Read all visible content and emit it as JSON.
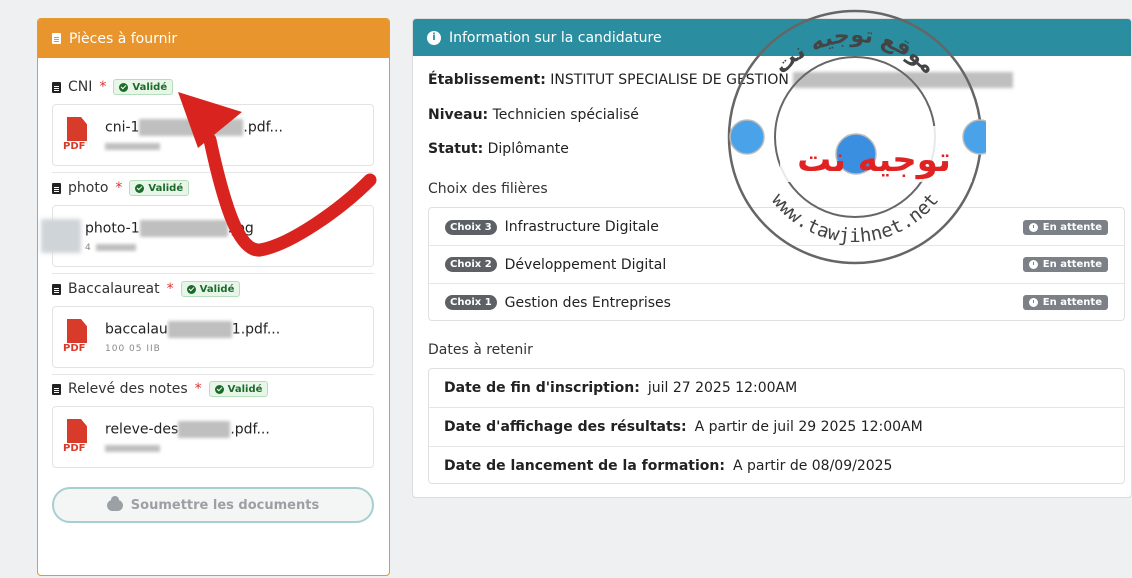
{
  "left": {
    "title": "Pièces à fournir",
    "required_mark": "*",
    "validated_label": "Validé",
    "pieces": [
      {
        "name": "CNI",
        "file_prefix": "cni-1",
        "file_suffix": ".pdf...",
        "file_type": "PDF"
      },
      {
        "name": "photo",
        "file_prefix": "photo-1",
        "file_suffix": ".jpg",
        "file_type": "",
        "size": "4"
      },
      {
        "name": "Baccalaureat",
        "file_prefix": "baccalau",
        "file_suffix": "1.pdf...",
        "file_type": "PDF",
        "size": "100 05 IIB"
      },
      {
        "name": "Relevé des notes",
        "file_prefix": "releve-des",
        "file_suffix": ".pdf...",
        "file_type": "PDF"
      }
    ],
    "submit_label": "Soumettre les documents"
  },
  "right": {
    "title": "Information sur la candidature",
    "info_icon": "i",
    "etablissement_label": "Établissement:",
    "etablissement_value": "INSTITUT SPECIALISE DE GESTION",
    "niveau_label": "Niveau:",
    "niveau_value": "Technicien spécialisé",
    "statut_label": "Statut:",
    "statut_value": "Diplômante",
    "choix_title": "Choix des filières",
    "status_label": "En attente",
    "choices": [
      {
        "pill": "Choix 3",
        "name": "Infrastructure Digitale"
      },
      {
        "pill": "Choix 2",
        "name": "Développement Digital"
      },
      {
        "pill": "Choix 1",
        "name": "Gestion des Entreprises"
      }
    ],
    "dates_title": "Dates à retenir",
    "dates": [
      {
        "label": "Date de fin d'inscription:",
        "value": "juil 27 2025 12:00AM"
      },
      {
        "label": "Date d'affichage des résultats:",
        "value": "A partir de juil 29 2025 12:00AM"
      },
      {
        "label": "Date de lancement de la formation:",
        "value": "A partir de 08/09/2025"
      }
    ]
  },
  "watermark": {
    "arabic_top": "موقع توجيه نت",
    "arabic_center": "توجيه نت",
    "url": "www.tawjihnet.net"
  },
  "colors": {
    "left_header": "#e8952e",
    "right_header": "#2a8ea0",
    "arrow": "#d9231f",
    "valide": "#1d6b2a"
  }
}
